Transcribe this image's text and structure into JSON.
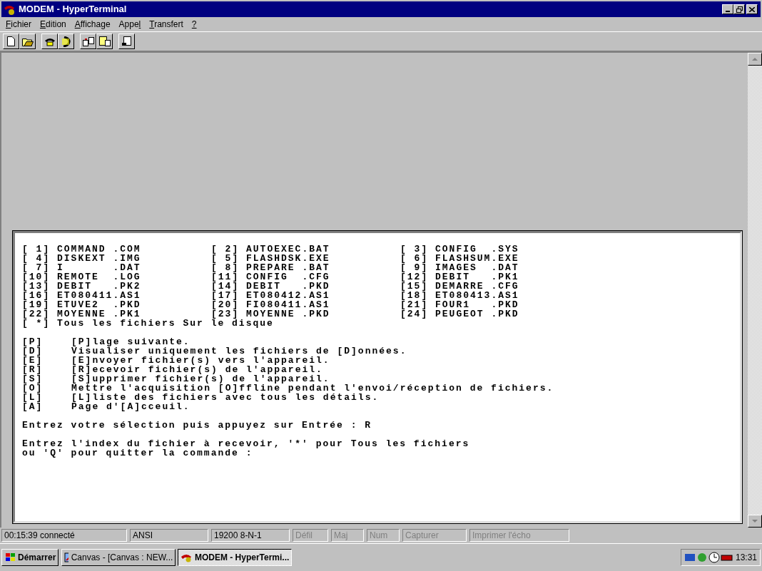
{
  "window": {
    "title": "MODEM - HyperTerminal"
  },
  "menu": [
    {
      "key": "F",
      "post": "ichier"
    },
    {
      "key": "E",
      "post": "dition"
    },
    {
      "key": "A",
      "post": "ffichage"
    },
    {
      "pre": "Appe",
      "key": "l"
    },
    {
      "key": "T",
      "post": "ransfert"
    },
    {
      "key": "?"
    }
  ],
  "terminal": {
    "files": [
      "[ 1] COMMAND .COM",
      "[ 2] AUTOEXEC.BAT",
      "[ 3] CONFIG  .SYS",
      "[ 4] DISKEXT .IMG",
      "[ 5] FLASHDSK.EXE",
      "[ 6] FLASHSUM.EXE",
      "[ 7] I       .DAT",
      "[ 8] PREPARE .BAT",
      "[ 9] IMAGES  .DAT",
      "[10] REMOTE  .LOG",
      "[11] CONFIG  .CFG",
      "[12] DEBIT   .PK1",
      "[13] DEBIT   .PK2",
      "[14] DEBIT   .PKD",
      "[15] DEMARRE .CFG",
      "[16] ET080411.AS1",
      "[17] ET080412.AS1",
      "[18] ET080413.AS1",
      "[19] ETUVE2  .PKD",
      "[20] FI080411.AS1",
      "[21] FOUR1   .PKD",
      "[22] MOYENNE .PK1",
      "[23] MOYENNE .PKD",
      "[24] PEUGEOT .PKD"
    ],
    "all_files": "[ *] Tous les fichiers Sur le disque",
    "options": [
      {
        "key": "[P]",
        "text": "[P]lage suivante."
      },
      {
        "key": "[D]",
        "text": "Visualiser uniquement les fichiers de [D]onnées."
      },
      {
        "key": "[E]",
        "text": "[E]nvoyer fichier(s) vers l'appareil."
      },
      {
        "key": "[R]",
        "text": "[R]ecevoir fichier(s) de l'appareil."
      },
      {
        "key": "[S]",
        "text": "[S]upprimer fichier(s) de l'appareil."
      },
      {
        "key": "[O]",
        "text": "Mettre l'acquisition [O]ffline pendant l'envoi/réception de fichiers."
      },
      {
        "key": "[L]",
        "text": "[L]liste des fichiers avec tous les détails."
      },
      {
        "key": "[A]",
        "text": "Page d'[A]cceuil."
      }
    ],
    "prompt": "Entrez votre sélection puis appuyez sur Entrée : R",
    "question": [
      "Entrez l'index du fichier à recevoir, '*' pour Tous les fichiers",
      "ou 'Q' pour quitter la commande :"
    ]
  },
  "status_bar": [
    {
      "text": "00:15:39 connecté",
      "disabled": false
    },
    {
      "text": "ANSI",
      "disabled": false
    },
    {
      "text": "19200 8-N-1",
      "disabled": false
    },
    {
      "text": "Défil",
      "disabled": true
    },
    {
      "text": "Maj",
      "disabled": true
    },
    {
      "text": "Num",
      "disabled": true
    },
    {
      "text": "Capturer",
      "disabled": true
    },
    {
      "text": "Imprimer l'écho",
      "disabled": true
    }
  ],
  "taskbar": {
    "start": "Démarrer",
    "tasks": [
      {
        "label": "Canvas  - [Canvas : NEW...",
        "selected": false
      },
      {
        "label": "MODEM - HyperTermi...",
        "selected": true
      }
    ],
    "clock": "13:31"
  }
}
